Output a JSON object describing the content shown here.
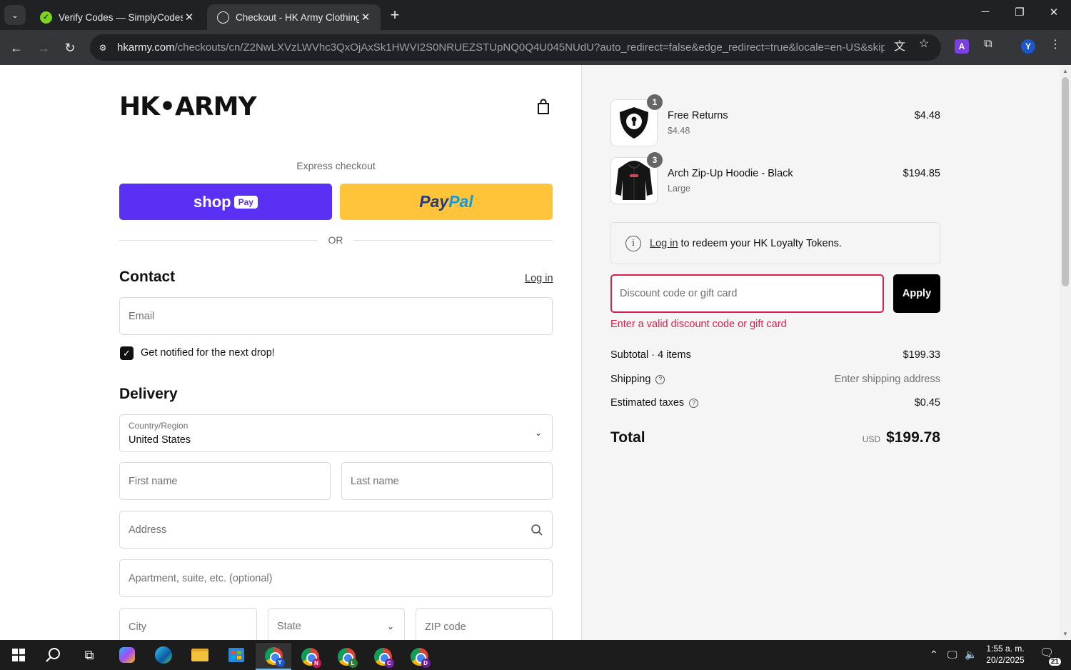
{
  "browser": {
    "tabs": [
      {
        "title": "Verify Codes — SimplyCodes",
        "active": false
      },
      {
        "title": "Checkout - HK Army Clothing",
        "active": true
      }
    ],
    "url_domain": "hkarmy.com",
    "url_path": "/checkouts/cn/Z2NwLXVzLWVhc3QxOjAxSk1HWVI2S0NRUEZSTUpNQ0Q4U045NUdU?auto_redirect=false&edge_redirect=true&locale=en-US&skip_sho...",
    "profile_initial": "Y",
    "extension_initial": "A"
  },
  "checkout": {
    "logo": "HK•ARMY",
    "express_label": "Express checkout",
    "shop_label": "shop",
    "shop_pay_badge": "Pay",
    "paypal_part1": "Pay",
    "paypal_part2": "Pal",
    "or_label": "OR",
    "contact": {
      "title": "Contact",
      "login_link": "Log in",
      "email_placeholder": "Email",
      "notify_checked": true,
      "notify_label": "Get notified for the next drop!"
    },
    "delivery": {
      "title": "Delivery",
      "country_label": "Country/Region",
      "country_value": "United States",
      "first_name_placeholder": "First name",
      "last_name_placeholder": "Last name",
      "address_placeholder": "Address",
      "apartment_placeholder": "Apartment, suite, etc. (optional)",
      "city_placeholder": "City",
      "state_placeholder": "State",
      "zip_placeholder": "ZIP code"
    }
  },
  "summary": {
    "items": [
      {
        "name": "Free Returns",
        "variant": "$4.48",
        "price": "$4.48",
        "qty": "1"
      },
      {
        "name": "Arch Zip-Up Hoodie - Black",
        "variant": "Large",
        "price": "$194.85",
        "qty": "3"
      }
    ],
    "loyalty_link": "Log in",
    "loyalty_text": "to redeem your HK Loyalty Tokens.",
    "discount_placeholder": "Discount code or gift card",
    "apply_label": "Apply",
    "discount_error": "Enter a valid discount code or gift card",
    "subtotal_label": "Subtotal · 4 items",
    "subtotal_value": "$199.33",
    "shipping_label": "Shipping",
    "shipping_value": "Enter shipping address",
    "taxes_label": "Estimated taxes",
    "taxes_value": "$0.45",
    "total_label": "Total",
    "total_currency": "USD",
    "total_value": "$199.78"
  },
  "taskbar": {
    "time": "1:55 a. m.",
    "date": "20/2/2025",
    "notification_count": "21",
    "chrome_profiles": [
      "Y",
      "N",
      "L",
      "C",
      "D"
    ]
  },
  "colors": {
    "shop_purple": "#5a31f4",
    "paypal_yellow": "#ffc439",
    "error_red": "#dd1d4a"
  }
}
